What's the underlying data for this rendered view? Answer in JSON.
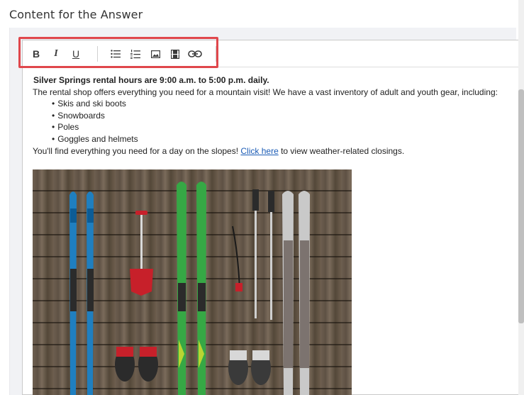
{
  "section": {
    "title": "Content for the Answer"
  },
  "toolbar": {
    "buttons": [
      {
        "name": "bold-button",
        "icon": "bold-icon",
        "glyph": "B"
      },
      {
        "name": "italic-button",
        "icon": "italic-icon",
        "glyph": "I"
      },
      {
        "name": "underline-button",
        "icon": "underline-icon",
        "glyph": "U"
      },
      {
        "name": "bulleted-list-button",
        "icon": "bulleted-list-icon"
      },
      {
        "name": "numbered-list-button",
        "icon": "numbered-list-icon"
      },
      {
        "name": "insert-image-button",
        "icon": "image-icon"
      },
      {
        "name": "insert-video-button",
        "icon": "film-icon"
      },
      {
        "name": "insert-link-button",
        "icon": "link-icon"
      }
    ],
    "highlight_color": "#e0474c"
  },
  "content": {
    "heading": "Silver Springs rental hours are 9:00 a.m. to 5:00 p.m. daily.",
    "intro": "The rental shop offers everything you need for a mountain visit! We have a vast inventory of adult and youth gear, including:",
    "list": [
      "Skis and ski boots",
      "Snowboards",
      "Poles",
      "Goggles and helmets"
    ],
    "closing_before_link": "You'll find everything you need for a day on the slopes!",
    "link_text": "Click here",
    "closing_after_link": "to view weather-related closings.",
    "link_color": "#1a5bb5"
  },
  "image": {
    "subject": "ski-equipment-photo"
  }
}
